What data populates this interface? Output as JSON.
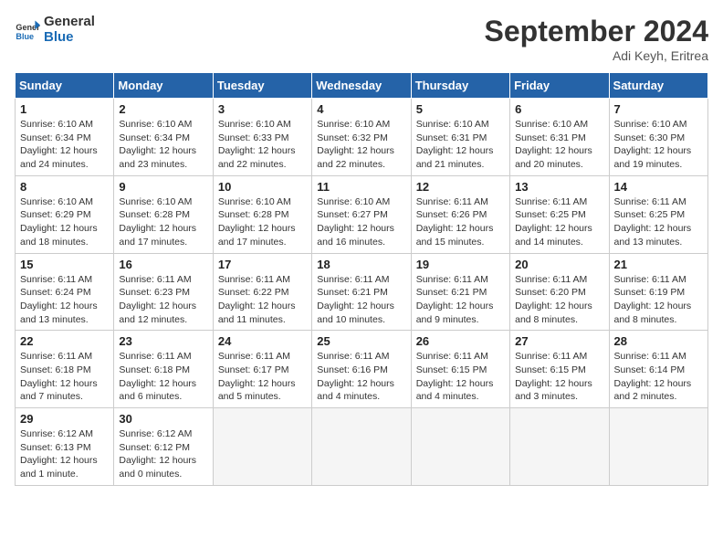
{
  "header": {
    "logo_general": "General",
    "logo_blue": "Blue",
    "month_title": "September 2024",
    "subtitle": "Adi Keyh, Eritrea"
  },
  "days_of_week": [
    "Sunday",
    "Monday",
    "Tuesday",
    "Wednesday",
    "Thursday",
    "Friday",
    "Saturday"
  ],
  "weeks": [
    [
      {
        "day": "1",
        "info": "Sunrise: 6:10 AM\nSunset: 6:34 PM\nDaylight: 12 hours\nand 24 minutes."
      },
      {
        "day": "2",
        "info": "Sunrise: 6:10 AM\nSunset: 6:34 PM\nDaylight: 12 hours\nand 23 minutes."
      },
      {
        "day": "3",
        "info": "Sunrise: 6:10 AM\nSunset: 6:33 PM\nDaylight: 12 hours\nand 22 minutes."
      },
      {
        "day": "4",
        "info": "Sunrise: 6:10 AM\nSunset: 6:32 PM\nDaylight: 12 hours\nand 22 minutes."
      },
      {
        "day": "5",
        "info": "Sunrise: 6:10 AM\nSunset: 6:31 PM\nDaylight: 12 hours\nand 21 minutes."
      },
      {
        "day": "6",
        "info": "Sunrise: 6:10 AM\nSunset: 6:31 PM\nDaylight: 12 hours\nand 20 minutes."
      },
      {
        "day": "7",
        "info": "Sunrise: 6:10 AM\nSunset: 6:30 PM\nDaylight: 12 hours\nand 19 minutes."
      }
    ],
    [
      {
        "day": "8",
        "info": "Sunrise: 6:10 AM\nSunset: 6:29 PM\nDaylight: 12 hours\nand 18 minutes."
      },
      {
        "day": "9",
        "info": "Sunrise: 6:10 AM\nSunset: 6:28 PM\nDaylight: 12 hours\nand 17 minutes."
      },
      {
        "day": "10",
        "info": "Sunrise: 6:10 AM\nSunset: 6:28 PM\nDaylight: 12 hours\nand 17 minutes."
      },
      {
        "day": "11",
        "info": "Sunrise: 6:10 AM\nSunset: 6:27 PM\nDaylight: 12 hours\nand 16 minutes."
      },
      {
        "day": "12",
        "info": "Sunrise: 6:11 AM\nSunset: 6:26 PM\nDaylight: 12 hours\nand 15 minutes."
      },
      {
        "day": "13",
        "info": "Sunrise: 6:11 AM\nSunset: 6:25 PM\nDaylight: 12 hours\nand 14 minutes."
      },
      {
        "day": "14",
        "info": "Sunrise: 6:11 AM\nSunset: 6:25 PM\nDaylight: 12 hours\nand 13 minutes."
      }
    ],
    [
      {
        "day": "15",
        "info": "Sunrise: 6:11 AM\nSunset: 6:24 PM\nDaylight: 12 hours\nand 13 minutes."
      },
      {
        "day": "16",
        "info": "Sunrise: 6:11 AM\nSunset: 6:23 PM\nDaylight: 12 hours\nand 12 minutes."
      },
      {
        "day": "17",
        "info": "Sunrise: 6:11 AM\nSunset: 6:22 PM\nDaylight: 12 hours\nand 11 minutes."
      },
      {
        "day": "18",
        "info": "Sunrise: 6:11 AM\nSunset: 6:21 PM\nDaylight: 12 hours\nand 10 minutes."
      },
      {
        "day": "19",
        "info": "Sunrise: 6:11 AM\nSunset: 6:21 PM\nDaylight: 12 hours\nand 9 minutes."
      },
      {
        "day": "20",
        "info": "Sunrise: 6:11 AM\nSunset: 6:20 PM\nDaylight: 12 hours\nand 8 minutes."
      },
      {
        "day": "21",
        "info": "Sunrise: 6:11 AM\nSunset: 6:19 PM\nDaylight: 12 hours\nand 8 minutes."
      }
    ],
    [
      {
        "day": "22",
        "info": "Sunrise: 6:11 AM\nSunset: 6:18 PM\nDaylight: 12 hours\nand 7 minutes."
      },
      {
        "day": "23",
        "info": "Sunrise: 6:11 AM\nSunset: 6:18 PM\nDaylight: 12 hours\nand 6 minutes."
      },
      {
        "day": "24",
        "info": "Sunrise: 6:11 AM\nSunset: 6:17 PM\nDaylight: 12 hours\nand 5 minutes."
      },
      {
        "day": "25",
        "info": "Sunrise: 6:11 AM\nSunset: 6:16 PM\nDaylight: 12 hours\nand 4 minutes."
      },
      {
        "day": "26",
        "info": "Sunrise: 6:11 AM\nSunset: 6:15 PM\nDaylight: 12 hours\nand 4 minutes."
      },
      {
        "day": "27",
        "info": "Sunrise: 6:11 AM\nSunset: 6:15 PM\nDaylight: 12 hours\nand 3 minutes."
      },
      {
        "day": "28",
        "info": "Sunrise: 6:11 AM\nSunset: 6:14 PM\nDaylight: 12 hours\nand 2 minutes."
      }
    ],
    [
      {
        "day": "29",
        "info": "Sunrise: 6:12 AM\nSunset: 6:13 PM\nDaylight: 12 hours\nand 1 minute."
      },
      {
        "day": "30",
        "info": "Sunrise: 6:12 AM\nSunset: 6:12 PM\nDaylight: 12 hours\nand 0 minutes."
      },
      {
        "day": "",
        "info": ""
      },
      {
        "day": "",
        "info": ""
      },
      {
        "day": "",
        "info": ""
      },
      {
        "day": "",
        "info": ""
      },
      {
        "day": "",
        "info": ""
      }
    ]
  ]
}
